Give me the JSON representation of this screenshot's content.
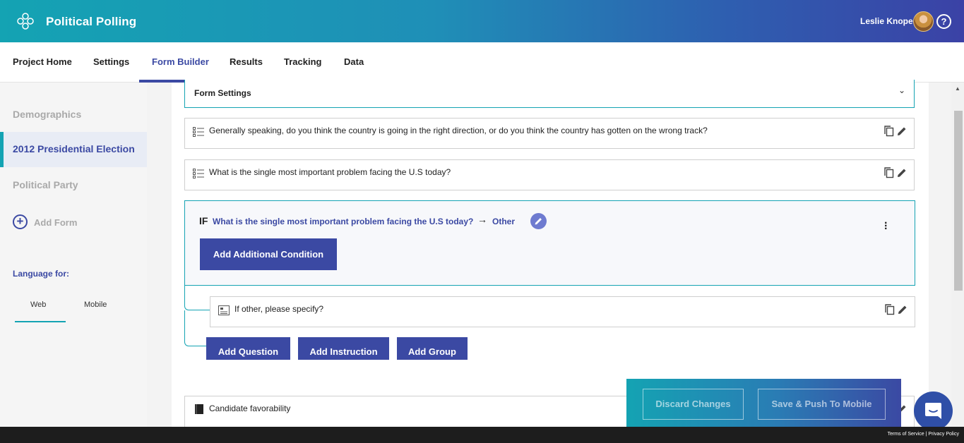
{
  "header": {
    "app_title": "Political Polling",
    "user_name": "Leslie Knope",
    "help": "?"
  },
  "tabs": [
    "Project Home",
    "Settings",
    "Form Builder",
    "Results",
    "Tracking",
    "Data"
  ],
  "active_tab": "Form Builder",
  "sidebar": {
    "items": [
      "Demographics",
      "2012 Presidential Election",
      "Political Party"
    ],
    "active": "2012 Presidential Election",
    "add_form": "Add Form",
    "language_label": "Language for:",
    "language_tabs": [
      "Web",
      "Mobile"
    ],
    "language_active": "Web"
  },
  "form_settings": {
    "label": "Form Settings"
  },
  "questions": [
    "Generally speaking, do you think the country is going in the right direction, or do you think the country has gotten on the wrong track?",
    "What is the single most important problem facing the U.S today?"
  ],
  "condition": {
    "if_label": "IF",
    "question": "What is the single most important problem facing the U.S today?",
    "answer": "Other",
    "add_condition_label": "Add Additional Condition",
    "nested_question": "If other, please specify?"
  },
  "add_buttons": [
    "Add Question",
    "Add Instruction",
    "Add Group"
  ],
  "section": {
    "label": "Candidate favorability"
  },
  "savebar": {
    "discard_label": "Discard Changes",
    "save_label": "Save & Push To Mobile"
  },
  "footer": {
    "terms": "Terms of Service",
    "privacy": "Privacy Policy"
  }
}
